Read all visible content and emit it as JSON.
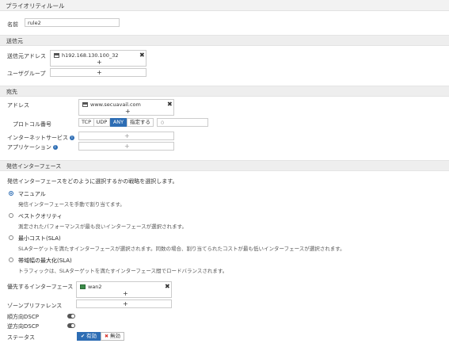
{
  "header": {
    "title": "プライオリティルール"
  },
  "name": {
    "label": "名前",
    "value": "rule2"
  },
  "source": {
    "section_title": "送信元",
    "address_label": "送信元アドレス",
    "address_entry": "h192.168.130.100_32",
    "user_group_label": "ユーザグループ"
  },
  "destination": {
    "section_title": "宛先",
    "address_label": "アドレス",
    "address_entry": "www.secuavail.com",
    "protocol_label": "プロトコル番号",
    "protocol_options": [
      "TCP",
      "UDP",
      "ANY",
      "指定する"
    ],
    "protocol_selected": "ANY",
    "protocol_value": "0",
    "internet_service_label": "インターネットサービス",
    "application_label": "アプリケーション"
  },
  "outgoing": {
    "section_title": "発信インターフェース",
    "description": "発信インターフェースをどのように選択するかの戦略を選択します。",
    "options": [
      {
        "title": "マニュアル",
        "desc": "発信インターフェースを手動で割り当てます。",
        "selected": true
      },
      {
        "title": "ベストクオリティ",
        "desc": "測定されたパフォーマンスが最も良いインターフェースが選択されます。",
        "selected": false
      },
      {
        "title": "最小コスト(SLA)",
        "desc": "SLAターゲットを満たすインターフェースが選択されます。同数の場合、割り当てられたコストが最も低いインターフェースが選択されます。",
        "selected": false
      },
      {
        "title": "帯域幅の最大化(SLA)",
        "desc": "トラフィックは、SLAターゲットを満たすインターフェース間でロードバランスされます。",
        "selected": false
      }
    ],
    "preferred_label": "優先するインターフェース",
    "preferred_entry": "wan2",
    "zone_label": "ゾーンプリファレンス",
    "forward_dscp_label": "順方向DSCP",
    "reverse_dscp_label": "逆方向DSCP",
    "status_label": "ステータス",
    "enable_label": "有効",
    "disable_label": "無効"
  },
  "symbols": {
    "plus": "+",
    "close": "✖",
    "info": "i",
    "check": "✔",
    "cross": "✖"
  },
  "colors": {
    "accent": "#2d6db4",
    "disable_icon": "#d9342b",
    "section_bg": "#eeeeee"
  }
}
